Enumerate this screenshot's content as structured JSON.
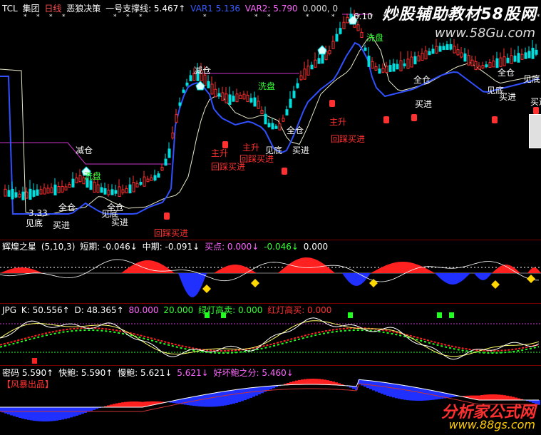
{
  "main": {
    "header": {
      "symbol": "TCL",
      "name": "集团",
      "period": "日线",
      "indicator": "恶狼决策",
      "support_label": "一号支撑线: 5.467↑",
      "var1": "VAR1  5.136",
      "var2": "VAR2: 5.790",
      "extra": "0.000, 0"
    },
    "price_low": "3.33",
    "price_high": "6.10",
    "labels": [
      {
        "text": "减仓",
        "color": "#ffffff"
      },
      {
        "text": "洗盘",
        "color": "#33ff33"
      },
      {
        "text": "全仓",
        "color": "#ffffff"
      },
      {
        "text": "见底",
        "color": "#ffffff"
      },
      {
        "text": "买进",
        "color": "#ffffff"
      },
      {
        "text": "全仓",
        "color": "#ffffff"
      },
      {
        "text": "见底",
        "color": "#ffffff"
      },
      {
        "text": "买进",
        "color": "#ffffff"
      },
      {
        "text": "回踩买进",
        "color": "#ff3030"
      },
      {
        "text": "减仓",
        "color": "#ffffff"
      },
      {
        "text": "洗盘",
        "color": "#33ff33"
      },
      {
        "text": "主升",
        "color": "#ff3030"
      },
      {
        "text": "回踩买进",
        "color": "#ff3030"
      },
      {
        "text": "主升",
        "color": "#ff3030"
      },
      {
        "text": "回踩买进",
        "color": "#ff3030"
      },
      {
        "text": "全仓",
        "color": "#ffffff"
      },
      {
        "text": "见底",
        "color": "#ffffff"
      },
      {
        "text": "买进",
        "color": "#ffffff"
      },
      {
        "text": "主升",
        "color": "#ff3030"
      },
      {
        "text": "回踩买进",
        "color": "#ff3030"
      },
      {
        "text": "洗盘",
        "color": "#33ff33"
      },
      {
        "text": "全仓",
        "color": "#ffffff"
      },
      {
        "text": "买进",
        "color": "#ffffff"
      },
      {
        "text": "全仓",
        "color": "#ffffff"
      },
      {
        "text": "见底",
        "color": "#ffffff"
      },
      {
        "text": "买进",
        "color": "#ffffff"
      },
      {
        "text": "见底",
        "color": "#ffffff"
      },
      {
        "text": "买进",
        "color": "#ffffff"
      }
    ]
  },
  "pane2": {
    "title": "辉煌之星",
    "params": "(5,10,3)",
    "short": "短期: -0.046↓",
    "mid": "中期: -0.091↓",
    "buy": "买点: 0.000↓",
    "v1": "-0.046↓",
    "v2": "0.000"
  },
  "pane3": {
    "title": "JPG",
    "k": "K: 50.556↑",
    "d": "D: 48.365↑",
    "v80": "80.000",
    "v20": "20.000",
    "green": "绿灯高卖: 0.000",
    "red": "红灯高买: 0.000"
  },
  "pane4": {
    "title": "密码 5.590↑",
    "fast": "快鲍: 5.590↑",
    "slow": "慢鲍: 5.621↓",
    "v": "5.621↓",
    "split": "好坏鲍之分: 5.460↓",
    "tag": "【风暴出品】"
  },
  "watermark": {
    "top": "炒股辅助教材58股网",
    "top_url": "www.58Gu.com",
    "bottom": "分析家公式网",
    "bottom_url": "www.88gs.com"
  },
  "colors": {
    "up": "#ff3030",
    "down": "#00e0e0",
    "blue": "#3050ff",
    "green": "#33ff33",
    "yellow": "#ffff00",
    "magenta": "#cc33cc"
  }
}
